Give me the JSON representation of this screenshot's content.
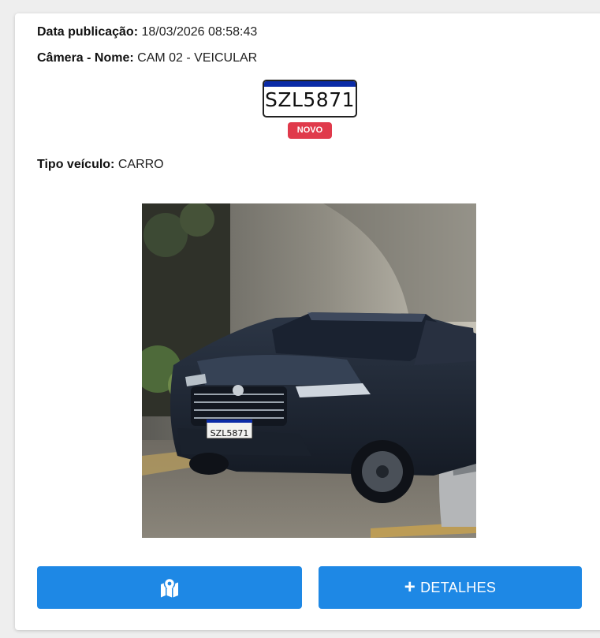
{
  "record": {
    "published_label": "Data publicação:",
    "published_value": "18/03/2026 08:58:43",
    "camera_label": "Câmera - Nome:",
    "camera_value": "CAM 02 - VEICULAR",
    "vehicle_type_label": "Tipo veículo:",
    "vehicle_type_value": "CARRO"
  },
  "plate": {
    "text": "SZL5871",
    "badge": "NOVO",
    "band_color": "#0b2ba6",
    "badge_color": "#e03a4b"
  },
  "photo": {
    "plate_text": "SZL5871",
    "subject": "dark SUV"
  },
  "actions": {
    "map_icon": "map-location-icon",
    "plus_icon": "plus-icon",
    "details_label": "DETALHES",
    "button_color": "#1e88e5"
  }
}
